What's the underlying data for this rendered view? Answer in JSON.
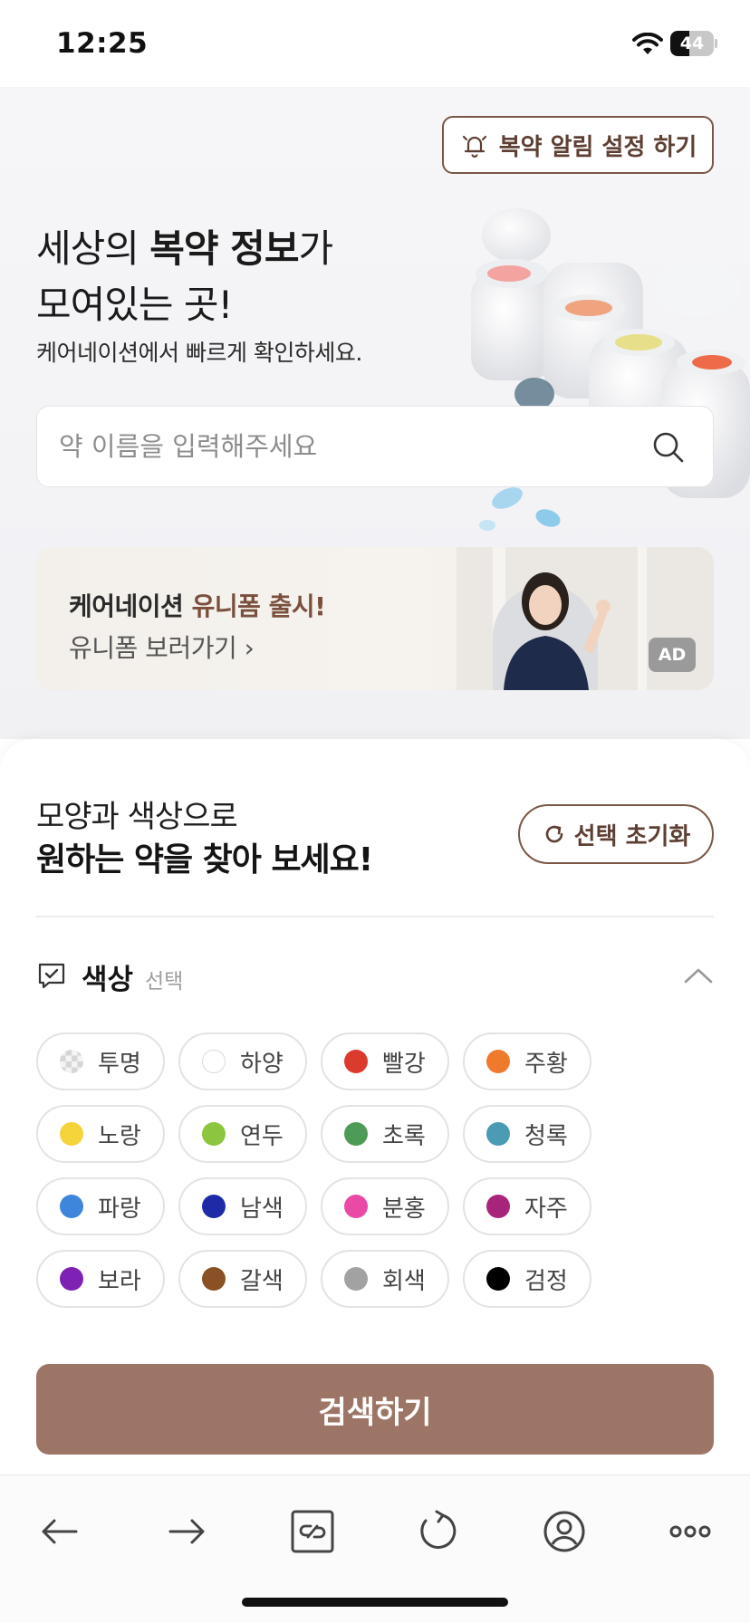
{
  "status_bar": {
    "time": "12:25",
    "battery": "44",
    "battery_level": 0.44
  },
  "hero": {
    "alarm_button_label": "복약 알림 설정 하기",
    "title_line1_pre": "세상의 ",
    "title_line1_bold": "복약 정보",
    "title_line1_post": "가",
    "title_line2": "모여있는 곳!",
    "subtitle": "케어네이션에서 빠르게 확인하세요.",
    "search_placeholder": "약 이름을 입력해주세요"
  },
  "banner": {
    "title_pre": "케어네이션 ",
    "title_accent": "유니폼 출시!",
    "link_label": "유니폼 보러가기 ›",
    "ad_label": "AD"
  },
  "filter": {
    "heading_line1": "모양과 색상으로",
    "heading_line2": "원하는 약을 찾아 보세요!",
    "reset_label": "선택 초기화",
    "section_title": "색상",
    "section_sub": "선택",
    "colors": [
      {
        "label": "투명",
        "hex": "clear"
      },
      {
        "label": "하양",
        "hex": "#ffffff"
      },
      {
        "label": "빨강",
        "hex": "#dd3a2e"
      },
      {
        "label": "주황",
        "hex": "#ef7a2c"
      },
      {
        "label": "노랑",
        "hex": "#f5d33b"
      },
      {
        "label": "연두",
        "hex": "#8cc63f"
      },
      {
        "label": "초록",
        "hex": "#4e9a57"
      },
      {
        "label": "청록",
        "hex": "#4a9bb3"
      },
      {
        "label": "파랑",
        "hex": "#3d86db"
      },
      {
        "label": "남색",
        "hex": "#1e2aa8"
      },
      {
        "label": "분홍",
        "hex": "#e84aa6"
      },
      {
        "label": "자주",
        "hex": "#a8237a"
      },
      {
        "label": "보라",
        "hex": "#7d22b4"
      },
      {
        "label": "갈색",
        "hex": "#8a5224"
      },
      {
        "label": "회색",
        "hex": "#a2a2a2"
      },
      {
        "label": "검정",
        "hex": "#000000"
      }
    ],
    "search_button_label": "검색하기"
  },
  "bottom_nav": {
    "items": [
      "back-icon",
      "forward-icon",
      "link-icon",
      "refresh-icon",
      "profile-icon",
      "more-icon"
    ]
  },
  "theme": {
    "accent": "#9d7566",
    "accent_dark": "#7a5646"
  }
}
